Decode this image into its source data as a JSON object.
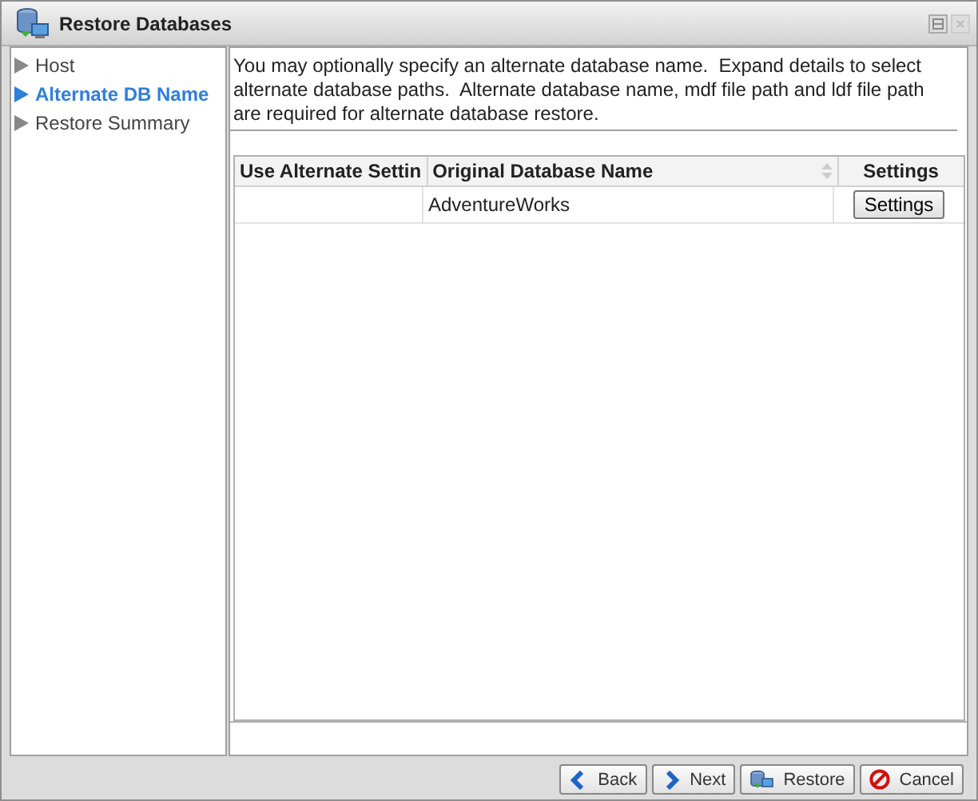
{
  "window": {
    "title": "Restore Databases"
  },
  "steps": [
    {
      "label": "Host",
      "selected": false
    },
    {
      "label": "Alternate DB Name",
      "selected": true
    },
    {
      "label": "Restore Summary",
      "selected": false
    }
  ],
  "description": "You may optionally specify an alternate database name.  Expand details to select alternate database paths.  Alternate database name, mdf file path and ldf file path are required for alternate database restore.",
  "table": {
    "columns": [
      {
        "label": "Use Alternate Settin",
        "sortable": false
      },
      {
        "label": "Original Database Name",
        "sortable": true
      },
      {
        "label": "Settings",
        "sortable": false
      }
    ],
    "rows": [
      {
        "use_alternate": "",
        "name": "AdventureWorks",
        "settings_button": "Settings"
      }
    ]
  },
  "buttons": [
    {
      "kind": "back",
      "label": "Back"
    },
    {
      "kind": "next",
      "label": "Next"
    },
    {
      "kind": "restore",
      "label": "Restore"
    },
    {
      "kind": "cancel",
      "label": "Cancel"
    }
  ]
}
